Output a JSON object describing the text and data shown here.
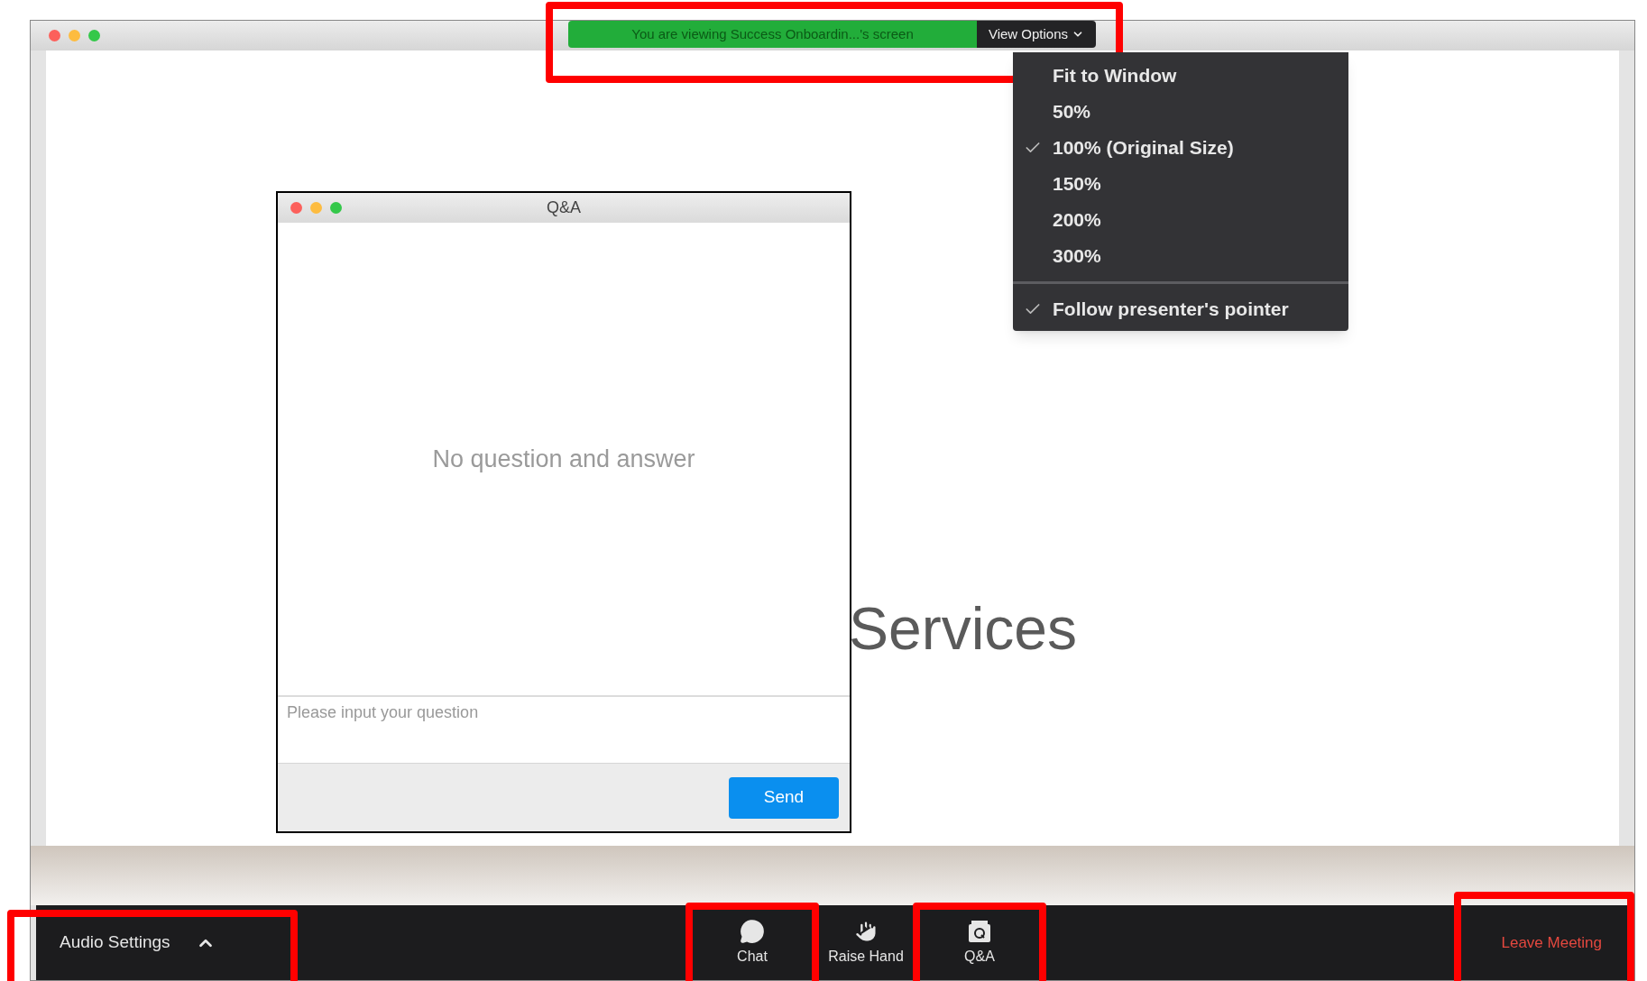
{
  "share_banner": {
    "text": "You are viewing Success Onboardin...'s screen",
    "highlighted": true,
    "view_options": {
      "label": "View Options",
      "expanded": true
    }
  },
  "view_menu": {
    "zoom_options": [
      {
        "label": "Fit to Window",
        "checked": false
      },
      {
        "label": "50%",
        "checked": false
      },
      {
        "label": "100% (Original Size)",
        "checked": true
      },
      {
        "label": "150%",
        "checked": false
      },
      {
        "label": "200%",
        "checked": false
      },
      {
        "label": "300%",
        "checked": false
      }
    ],
    "pointer_option": {
      "label": "Follow presenter's pointer",
      "checked": true
    }
  },
  "shared_content": {
    "text": "Services"
  },
  "qa_window": {
    "title": "Q&A",
    "empty_text": "No question and answer",
    "question_field": {
      "placeholder": "Please input your question"
    },
    "send_button": "Send"
  },
  "toolbar": {
    "audio_settings": {
      "label": "Audio Settings",
      "highlighted": true
    },
    "buttons": [
      {
        "kind": "chat",
        "label": "Chat",
        "highlighted": true
      },
      {
        "kind": "raise_hand",
        "label": "Raise Hand",
        "highlighted": false
      },
      {
        "kind": "qa",
        "label": "Q&A",
        "highlighted": true
      }
    ],
    "leave_meeting": {
      "label": "Leave Meeting",
      "highlighted": true
    }
  }
}
